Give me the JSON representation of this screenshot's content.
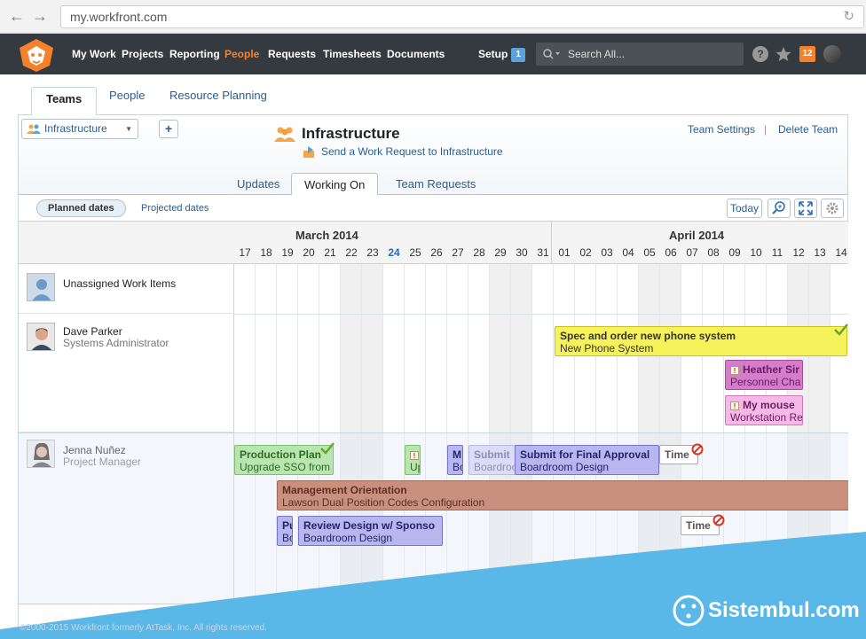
{
  "browser": {
    "url": "my.workfront.com"
  },
  "nav": {
    "items": [
      "My Work",
      "Projects",
      "Reporting",
      "People",
      "Requests",
      "Timesheets",
      "Documents"
    ],
    "active": "People",
    "setup_label": "Setup",
    "setup_badge": "1",
    "search_placeholder": "Search All...",
    "notifications": "12"
  },
  "tabs": {
    "items": [
      "Teams",
      "People",
      "Resource Planning"
    ],
    "selected": "Teams"
  },
  "team": {
    "dropdown": "Infrastructure",
    "title": "Infrastructure",
    "send_request": "Send a Work Request to Infrastructure",
    "settings": "Team Settings",
    "delete": "Delete Team"
  },
  "subtabs": {
    "items": [
      "Updates",
      "Working On",
      "Team Requests"
    ],
    "selected": "Working On"
  },
  "toolbar": {
    "planned": "Planned dates",
    "projected": "Projected dates",
    "today": "Today"
  },
  "calendar": {
    "months": [
      "March 2014",
      "April 2014"
    ],
    "days": [
      "17",
      "18",
      "19",
      "20",
      "21",
      "22",
      "23",
      "24",
      "25",
      "26",
      "27",
      "28",
      "29",
      "30",
      "31",
      "01",
      "02",
      "03",
      "04",
      "05",
      "06",
      "07",
      "08",
      "09",
      "10",
      "11",
      "12",
      "13",
      "14"
    ],
    "today": "24"
  },
  "people": [
    {
      "name": "Unassigned Work Items",
      "role": ""
    },
    {
      "name": "Dave Parker",
      "role": "Systems Administrator"
    },
    {
      "name": "Jenna Nuñez",
      "role": "Project Manager"
    }
  ],
  "tasks": [
    {
      "title": "Spec and order new phone system",
      "project": "New Phone System",
      "color": "#f6f25b",
      "border": "#c8c220",
      "text": "#333"
    },
    {
      "title": "Heather Sir",
      "project": "Personnel Cha",
      "color": "#d57dca",
      "border": "#a94a9c",
      "text": "#6a1d60"
    },
    {
      "title": "My mouse",
      "project": "Workstation Re",
      "color": "#f6b8e6",
      "border": "#cf7ab8",
      "text": "#6a1d60"
    },
    {
      "title": "Production Plan",
      "project": "Upgrade SSO from",
      "color": "#b9e6b0",
      "border": "#7cbf6f",
      "text": "#2e6b22"
    },
    {
      "title": "",
      "project": "Up",
      "color": "#b9e6b0",
      "border": "#7cbf6f",
      "text": "#2e6b22"
    },
    {
      "title": "M",
      "project": "Bo",
      "color": "#b7b6ee",
      "border": "#7674c9",
      "text": "#24236b"
    },
    {
      "title": "Submit",
      "project": "Boardroo",
      "color": "#dcdcf6",
      "border": "#b9b8e6",
      "text": "#8e8db8"
    },
    {
      "title": "Submit for Final Approval",
      "project": "Boardroom Design",
      "color": "#b7b6ee",
      "border": "#7674c9",
      "text": "#24236b"
    },
    {
      "title": "Time",
      "project": "",
      "color": "#fff",
      "border": "#aaa",
      "text": "#555"
    },
    {
      "title": "Management Orientation",
      "project": "Lawson Dual Position Codes Configuration",
      "color": "#c9907e",
      "border": "#9f6a58",
      "text": "#5d2f22"
    },
    {
      "title": "Pu",
      "project": "Bo",
      "color": "#b7b6ee",
      "border": "#7674c9",
      "text": "#24236b"
    },
    {
      "title": "Review Design w/ Sponso",
      "project": "Boardroom Design",
      "color": "#b7b6ee",
      "border": "#7674c9",
      "text": "#24236b"
    },
    {
      "title": "Time",
      "project": "",
      "color": "#fff",
      "border": "#aaa",
      "text": "#555"
    }
  ],
  "brand": {
    "watermark": "Sistembul.com",
    "copyright": "©2000-2015 Workfront formerly AtTask, Inc. All rights reserved."
  },
  "icons": [
    "logo-icon",
    "search-icon",
    "help-icon",
    "star-icon",
    "team-icon",
    "plus-icon",
    "zoom-icon",
    "expand-icon",
    "gear-icon",
    "check-icon",
    "blocked-icon",
    "alert-icon"
  ]
}
